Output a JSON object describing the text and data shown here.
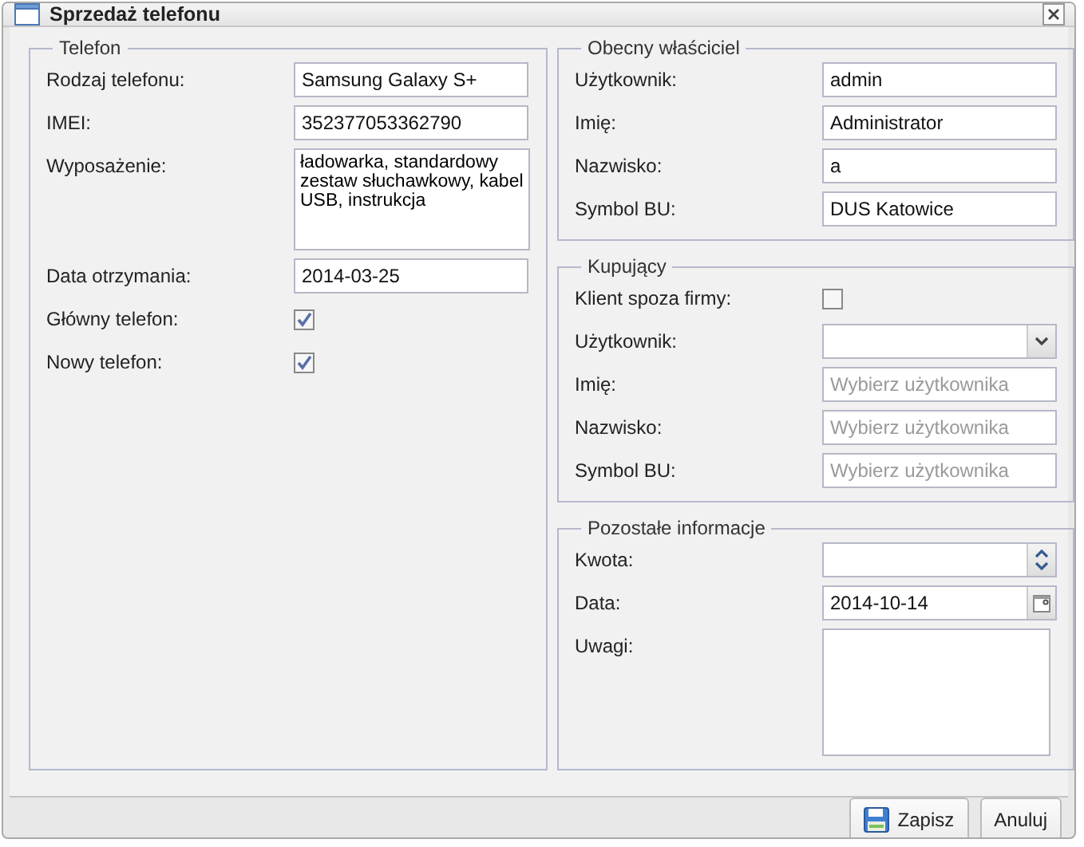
{
  "window": {
    "title": "Sprzedaż telefonu"
  },
  "left": [
    {
      "legend": "Telefon",
      "fields": [
        {
          "label": "Rodzaj telefonu:",
          "kind": "text",
          "value": "Samsung Galaxy S+"
        },
        {
          "label": "IMEI:",
          "kind": "text",
          "value": "352377053362790"
        },
        {
          "label": "Wyposażenie:",
          "kind": "textarea",
          "value": "ładowarka, standardowy zestaw słuchawkowy, kabel USB, instrukcja"
        },
        {
          "label": "Data otrzymania:",
          "kind": "text",
          "value": "2014-03-25"
        },
        {
          "label": "Główny telefon:",
          "kind": "checkbox",
          "checked": true
        },
        {
          "label": "Nowy telefon:",
          "kind": "checkbox",
          "checked": true
        }
      ]
    }
  ],
  "right": [
    {
      "legend": "Obecny właściciel",
      "fields": [
        {
          "label": "Użytkownik:",
          "kind": "text",
          "value": "admin"
        },
        {
          "label": "Imię:",
          "kind": "text",
          "value": "Administrator"
        },
        {
          "label": "Nazwisko:",
          "kind": "text",
          "value": "a"
        },
        {
          "label": "Symbol BU:",
          "kind": "text",
          "value": "DUS Katowice"
        }
      ]
    },
    {
      "legend": "Kupujący",
      "fields": [
        {
          "label": "Klient spoza firmy:",
          "kind": "checkbox",
          "checked": false
        },
        {
          "label": "Użytkownik:",
          "kind": "select"
        },
        {
          "label": "Imię:",
          "kind": "text",
          "placeholder": "Wybierz użytkownika"
        },
        {
          "label": "Nazwisko:",
          "kind": "text",
          "placeholder": "Wybierz użytkownika"
        },
        {
          "label": "Symbol BU:",
          "kind": "text",
          "placeholder": "Wybierz użytkownika"
        }
      ]
    },
    {
      "legend": "Pozostałe informacje",
      "fields": [
        {
          "label": "Kwota:",
          "kind": "spinner"
        },
        {
          "label": "Data:",
          "kind": "date",
          "value": "2014-10-14"
        },
        {
          "label": "Uwagi:",
          "kind": "textarea"
        }
      ]
    }
  ],
  "buttons": [
    {
      "label": "Zapisz",
      "kind": "save"
    },
    {
      "label": "Anuluj",
      "kind": "plain"
    }
  ]
}
